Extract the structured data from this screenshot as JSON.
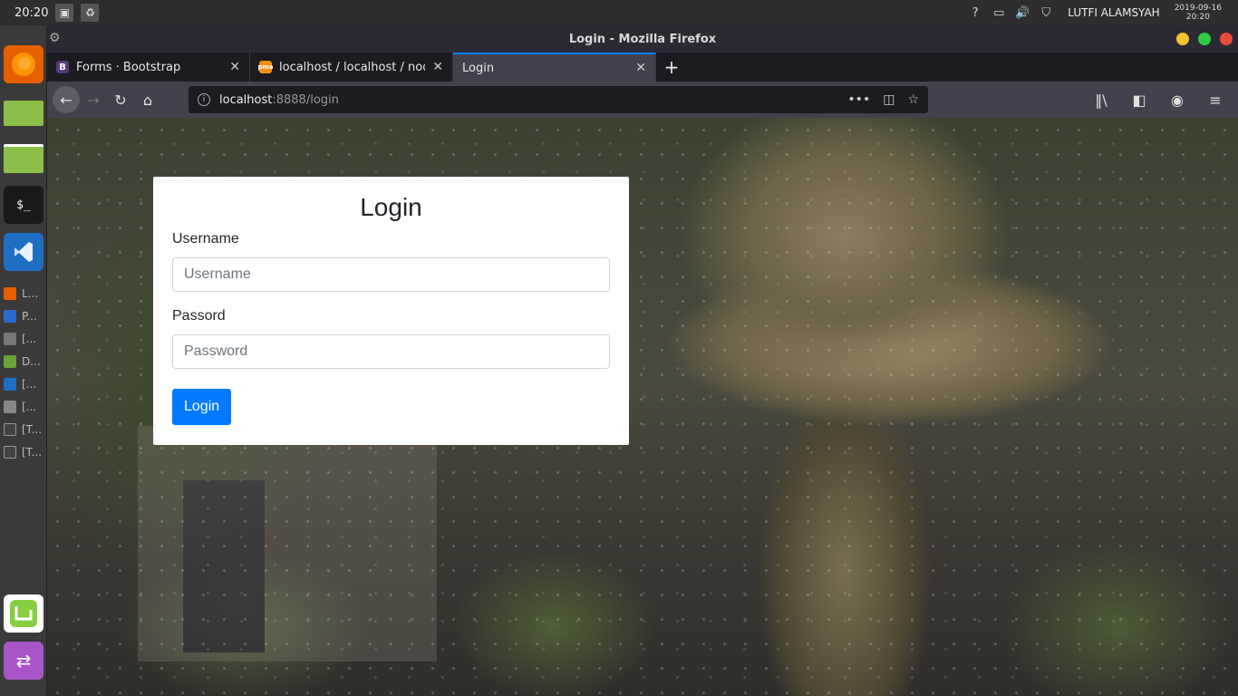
{
  "system": {
    "clock": "20:20",
    "user": "LUTFI ALAMSYAH",
    "date": "2019-09-16",
    "time": "20:20"
  },
  "dock": {
    "items": [
      {
        "label": "L..."
      },
      {
        "label": "P..."
      },
      {
        "label": "[..."
      },
      {
        "label": "D..."
      },
      {
        "label": "[..."
      },
      {
        "label": "[..."
      },
      {
        "label": "[T..."
      },
      {
        "label": "[T..."
      }
    ]
  },
  "window": {
    "title": "Login - Mozilla Firefox"
  },
  "tabs": [
    {
      "title": "Forms · Bootstrap",
      "favicon": "B",
      "color": "#563d7c"
    },
    {
      "title": "localhost / localhost / nodejs",
      "favicon": "pma",
      "color": "#f29111"
    },
    {
      "title": "Login",
      "favicon": "",
      "color": ""
    }
  ],
  "urlbar": {
    "host": "localhost",
    "path": ":8888/login"
  },
  "login": {
    "heading": "Login",
    "username_label": "Username",
    "username_placeholder": "Username",
    "password_label": "Passord",
    "password_placeholder": "Password",
    "button": "Login"
  },
  "colors": {
    "primary": "#007bff",
    "tab_accent": "#0a84ff",
    "close_red": "#e94b3c",
    "max_green": "#2ecc40",
    "min_yellow": "#f5c12e"
  }
}
